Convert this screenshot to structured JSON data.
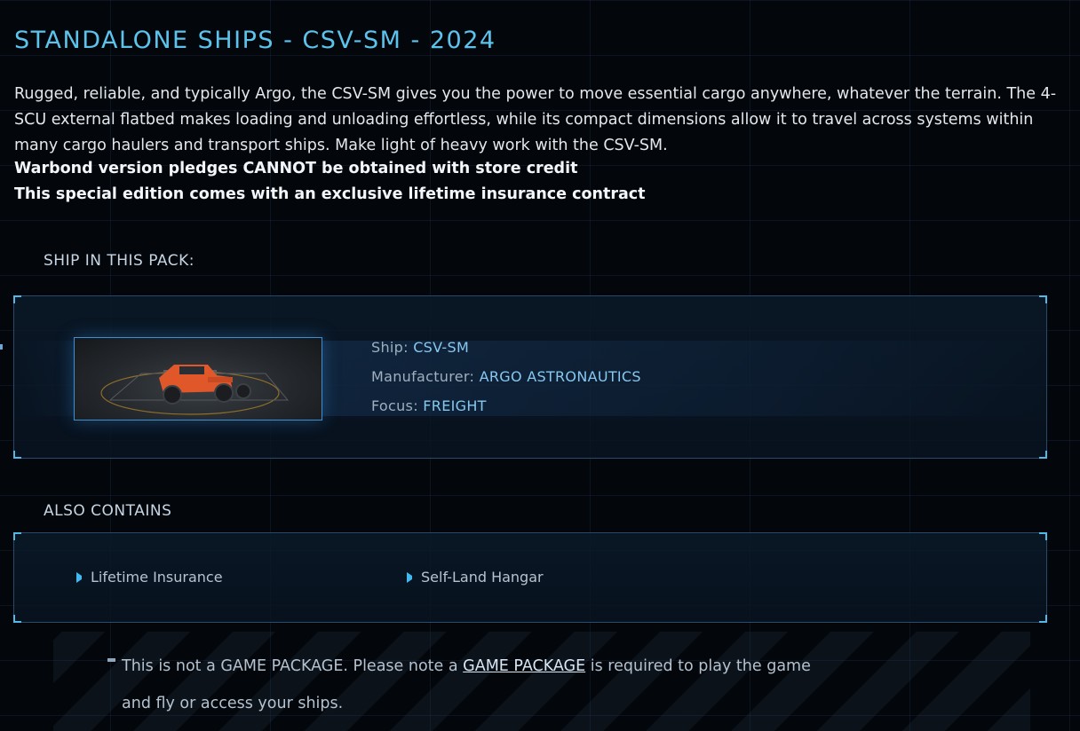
{
  "title": "STANDALONE SHIPS - CSV-SM - 2024",
  "description": "Rugged, reliable, and typically Argo, the CSV-SM gives you the power to move essential cargo anywhere, whatever the terrain. The 4-SCU external flatbed makes loading and unloading effortless, while its compact dimensions allow it to travel across systems within many cargo haulers and transport ships. Make light of heavy work with the CSV-SM.",
  "notices": [
    "Warbond version pledges CANNOT be obtained with store credit",
    "This special edition comes with an exclusive lifetime insurance contract"
  ],
  "ship_section": {
    "label": "SHIP IN THIS PACK:",
    "ship": {
      "ship_key": "Ship:",
      "ship_value": "CSV-SM",
      "manufacturer_key": "Manufacturer:",
      "manufacturer_value": "ARGO ASTRONAUTICS",
      "focus_key": "Focus:",
      "focus_value": "FREIGHT"
    }
  },
  "also_contains": {
    "label": "ALSO CONTAINS",
    "items": [
      "Lifetime Insurance",
      "Self-Land Hangar"
    ]
  },
  "note": {
    "before": "This is not a GAME PACKAGE. Please note a ",
    "link": "GAME PACKAGE",
    "after": " is required to play the game and fly or access your ships."
  },
  "colors": {
    "accent": "#5cc4ec",
    "background": "#03070c",
    "ship_body": "#e0582a"
  }
}
